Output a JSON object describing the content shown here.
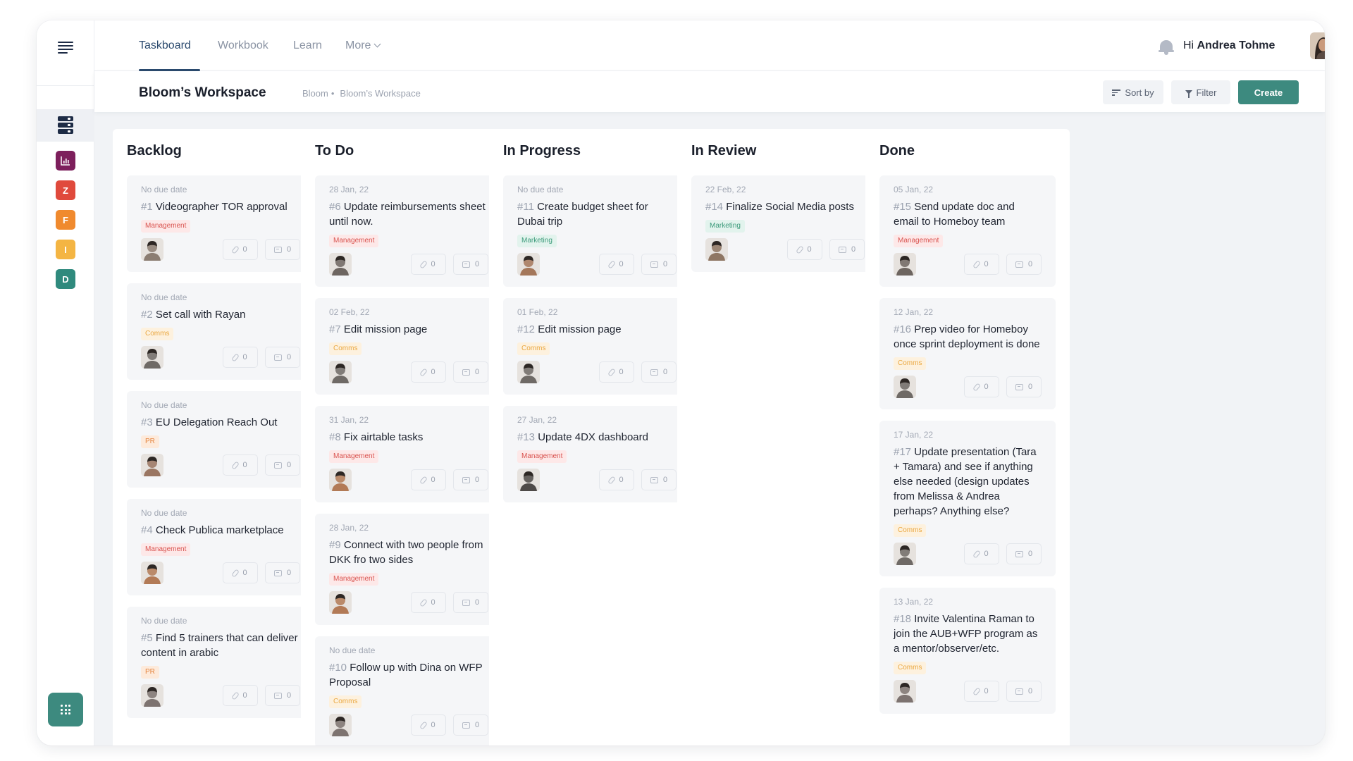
{
  "nav": {
    "tabs": [
      "Taskboard",
      "Workbook",
      "Learn",
      "More"
    ],
    "greeting_prefix": "Hi",
    "user_name": "Andrea Tohme"
  },
  "sidebar": {
    "workspaces": [
      {
        "icon": "chart-icon",
        "letter": "",
        "color": "#7d1f5c"
      },
      {
        "icon": "",
        "letter": "Z",
        "color": "#e04a3c"
      },
      {
        "icon": "",
        "letter": "F",
        "color": "#f08a2e"
      },
      {
        "icon": "",
        "letter": "I",
        "color": "#f4b543"
      },
      {
        "icon": "",
        "letter": "D",
        "color": "#2f8a7d"
      }
    ]
  },
  "subheader": {
    "title": "Bloom’s Workspace",
    "breadcrumb": [
      "Bloom",
      "Bloom’s Workspace"
    ],
    "sort_label": "Sort by",
    "filter_label": "Filter",
    "create_label": "Create"
  },
  "columns": [
    {
      "title": "Backlog",
      "cards": [
        {
          "due": "No due date",
          "num": "#1",
          "title": "Videographer TOR approval",
          "tag": "Management",
          "tag_type": "mgmt",
          "attachments": "0",
          "comments": "0",
          "avatar_tone": "#8b7d72"
        },
        {
          "due": "No due date",
          "num": "#2",
          "title": "Set call with Rayan",
          "tag": "Comms",
          "tag_type": "comms",
          "attachments": "0",
          "comments": "0",
          "avatar_tone": "#6f6a66"
        },
        {
          "due": "No due date",
          "num": "#3",
          "title": "EU Delegation Reach Out",
          "tag": "PR",
          "tag_type": "pr",
          "attachments": "0",
          "comments": "0",
          "avatar_tone": "#9a7662"
        },
        {
          "due": "No due date",
          "num": "#4",
          "title": "Check Publica marketplace",
          "tag": "Management",
          "tag_type": "mgmt",
          "attachments": "0",
          "comments": "0",
          "avatar_tone": "#b27a56"
        },
        {
          "due": "No due date",
          "num": "#5",
          "title": "Find 5 trainers that can deliver content in arabic",
          "tag": "PR",
          "tag_type": "pr",
          "attachments": "0",
          "comments": "0",
          "avatar_tone": "#7d7370"
        }
      ]
    },
    {
      "title": "To Do",
      "cards": [
        {
          "due": "28 Jan, 22",
          "num": "#6",
          "title": "Update reimbursements sheet until now.",
          "tag": "Management",
          "tag_type": "mgmt",
          "attachments": "0",
          "comments": "0",
          "avatar_tone": "#6d6560"
        },
        {
          "due": "02 Feb, 22",
          "num": "#7",
          "title": "Edit mission page",
          "tag": "Comms",
          "tag_type": "comms",
          "attachments": "0",
          "comments": "0",
          "avatar_tone": "#6f6a66"
        },
        {
          "due": "31 Jan, 22",
          "num": "#8",
          "title": "Fix airtable tasks",
          "tag": "Management",
          "tag_type": "mgmt",
          "attachments": "0",
          "comments": "0",
          "avatar_tone": "#b27a56"
        },
        {
          "due": "28 Jan, 22",
          "num": "#9",
          "title": "Connect with two people from DKK fro two sides",
          "tag": "Management",
          "tag_type": "mgmt",
          "attachments": "0",
          "comments": "0",
          "avatar_tone": "#b27a56"
        },
        {
          "due": "No due date",
          "num": "#10",
          "title": "Follow up with Dina on WFP Proposal",
          "tag": "Comms",
          "tag_type": "comms",
          "attachments": "0",
          "comments": "0",
          "avatar_tone": "#7d7370"
        }
      ]
    },
    {
      "title": "In Progress",
      "cards": [
        {
          "due": "No due date",
          "num": "#11",
          "title": "Create budget sheet for Dubai trip",
          "tag": "Marketing",
          "tag_type": "mkt",
          "attachments": "0",
          "comments": "0",
          "avatar_tone": "#a4775a"
        },
        {
          "due": "01 Feb, 22",
          "num": "#12",
          "title": "Edit mission page",
          "tag": "Comms",
          "tag_type": "comms",
          "attachments": "0",
          "comments": "0",
          "avatar_tone": "#6f6a66"
        },
        {
          "due": "27 Jan, 22",
          "num": "#13",
          "title": "Update 4DX dashboard",
          "tag": "Management",
          "tag_type": "mgmt",
          "attachments": "0",
          "comments": "0",
          "avatar_tone": "#4e4a48"
        }
      ]
    },
    {
      "title": "In Review",
      "cards": [
        {
          "due": "22 Feb, 22",
          "num": "#14",
          "title": "Finalize Social Media posts",
          "tag": "Marketing",
          "tag_type": "mkt",
          "attachments": "0",
          "comments": "0",
          "avatar_tone": "#8e7663"
        }
      ]
    },
    {
      "title": "Done",
      "cards": [
        {
          "due": "05 Jan, 22",
          "num": "#15",
          "title": "Send update doc and email to Homeboy team",
          "tag": "Management",
          "tag_type": "mgmt",
          "attachments": "0",
          "comments": "0",
          "avatar_tone": "#6d6560"
        },
        {
          "due": "12 Jan, 22",
          "num": "#16",
          "title": "Prep video for Homeboy once sprint deployment is done",
          "tag": "Comms",
          "tag_type": "comms",
          "attachments": "0",
          "comments": "0",
          "avatar_tone": "#6f6a66"
        },
        {
          "due": "17 Jan, 22",
          "num": "#17",
          "title": "Update presentation (Tara + Tamara) and see if anything else needed (design updates from Melissa & Andrea perhaps? Anything else?",
          "tag": "Comms",
          "tag_type": "comms",
          "attachments": "0",
          "comments": "0",
          "avatar_tone": "#6f6a66"
        },
        {
          "due": "13 Jan, 22",
          "num": "#18",
          "title": "Invite Valentina Raman to join the AUB+WFP program as a mentor/observer/etc.",
          "tag": "Comms",
          "tag_type": "comms",
          "attachments": "0",
          "comments": "0",
          "avatar_tone": "#7d7370"
        }
      ]
    }
  ]
}
